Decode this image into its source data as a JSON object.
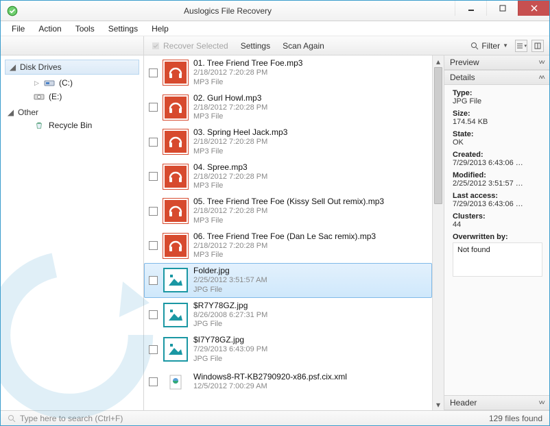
{
  "window": {
    "title": "Auslogics File Recovery"
  },
  "menu": {
    "file": "File",
    "action": "Action",
    "tools": "Tools",
    "settings": "Settings",
    "help": "Help"
  },
  "toolbar": {
    "recover": "Recover Selected",
    "settings": "Settings",
    "scan_again": "Scan Again",
    "filter": "Filter"
  },
  "tree": {
    "drives_header": "Disk Drives",
    "c_drive": "(C:)",
    "e_drive": "(E:)",
    "other_header": "Other",
    "recycle_bin": "Recycle Bin"
  },
  "files": [
    {
      "name": "01. Tree Friend Tree Foe.mp3",
      "date": "2/18/2012 7:20:28 PM",
      "type": "MP3 File",
      "kind": "mp3"
    },
    {
      "name": "02. Gurl Howl.mp3",
      "date": "2/18/2012 7:20:28 PM",
      "type": "MP3 File",
      "kind": "mp3"
    },
    {
      "name": "03. Spring Heel Jack.mp3",
      "date": "2/18/2012 7:20:28 PM",
      "type": "MP3 File",
      "kind": "mp3"
    },
    {
      "name": "04. Spree.mp3",
      "date": "2/18/2012 7:20:28 PM",
      "type": "MP3 File",
      "kind": "mp3"
    },
    {
      "name": "05. Tree Friend Tree Foe (Kissy Sell Out remix).mp3",
      "date": "2/18/2012 7:20:28 PM",
      "type": "MP3 File",
      "kind": "mp3"
    },
    {
      "name": "06. Tree Friend Tree Foe (Dan Le Sac remix).mp3",
      "date": "2/18/2012 7:20:28 PM",
      "type": "MP3 File",
      "kind": "mp3"
    },
    {
      "name": "Folder.jpg",
      "date": "2/25/2012 3:51:57 AM",
      "type": "JPG File",
      "kind": "jpg",
      "selected": true
    },
    {
      "name": "$R7Y78GZ.jpg",
      "date": "8/26/2008 6:27:31 PM",
      "type": "JPG File",
      "kind": "jpg"
    },
    {
      "name": "$I7Y78GZ.jpg",
      "date": "7/29/2013 6:43:09 PM",
      "type": "JPG File",
      "kind": "jpg"
    },
    {
      "name": "Windows8-RT-KB2790920-x86.psf.cix.xml",
      "date": "12/5/2012 7:00:29 AM",
      "type": "",
      "kind": "xml"
    }
  ],
  "panel": {
    "preview": "Preview",
    "details": "Details",
    "header": "Header",
    "type_lbl": "Type:",
    "type_val": "JPG File",
    "size_lbl": "Size:",
    "size_val": "174.54 KB",
    "state_lbl": "State:",
    "state_val": "OK",
    "created_lbl": "Created:",
    "created_val": "7/29/2013 6:43:06 …",
    "modified_lbl": "Modified:",
    "modified_val": "2/25/2012 3:51:57 …",
    "last_lbl": "Last access:",
    "last_val": "7/29/2013 6:43:06 …",
    "clusters_lbl": "Clusters:",
    "clusters_val": "44",
    "overwritten_lbl": "Overwritten by:",
    "overwritten_val": "Not found"
  },
  "status": {
    "search_placeholder": "Type here to search (Ctrl+F)",
    "count": "129 files found"
  }
}
